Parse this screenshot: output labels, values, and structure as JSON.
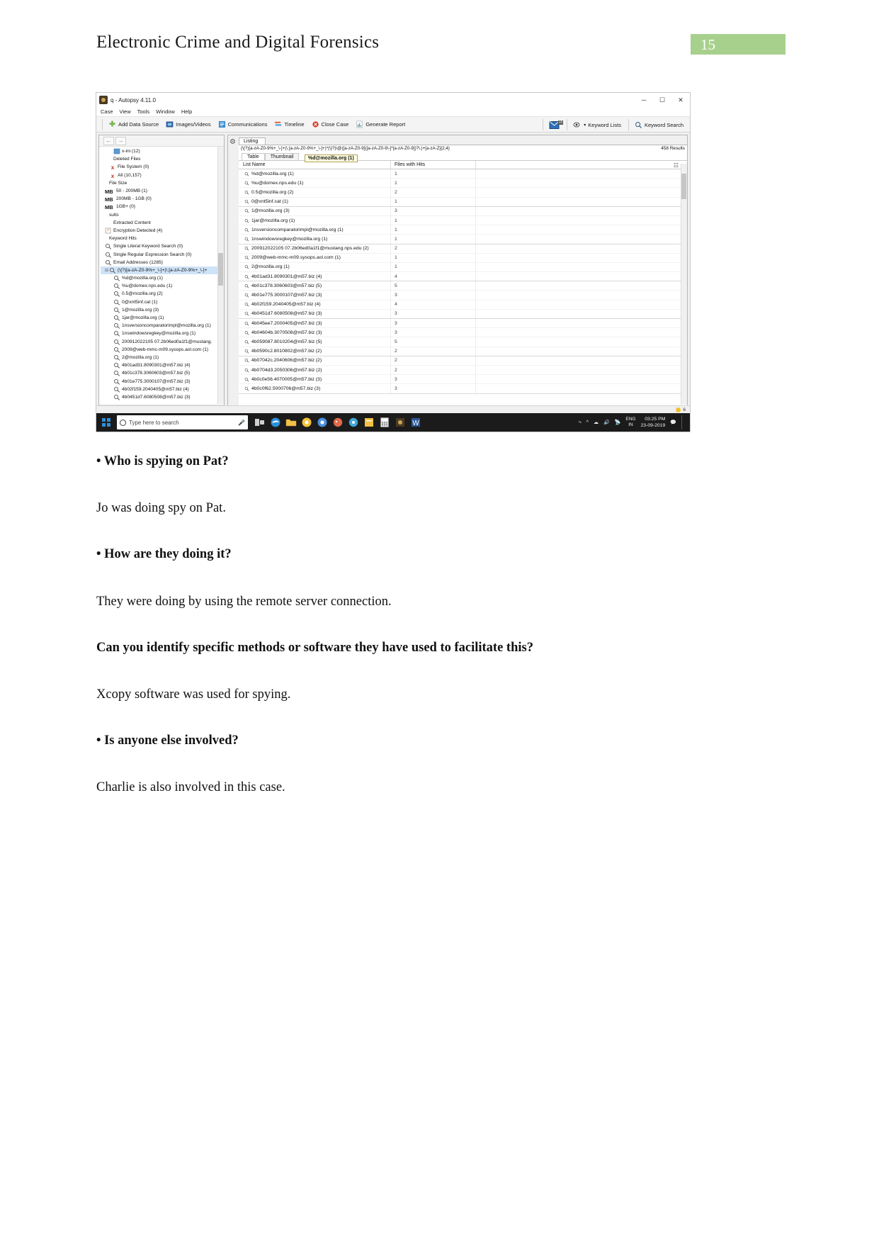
{
  "header": {
    "title": "Electronic Crime and Digital Forensics",
    "page_number": "15",
    "badge_color": "#a8d08d"
  },
  "screenshot": {
    "window": {
      "title": "q - Autopsy 4.11.0",
      "icon": "autopsy-icon",
      "minimize": "─",
      "maximize": "☐",
      "close": "✕"
    },
    "menubar": [
      "Case",
      "View",
      "Tools",
      "Window",
      "Help"
    ],
    "toolbar": [
      {
        "label": "Add Data Source",
        "icon": "plus-icon"
      },
      {
        "label": "Images/Videos",
        "icon": "images-icon"
      },
      {
        "label": "Communications",
        "icon": "communications-icon"
      },
      {
        "label": "Timeline",
        "icon": "timeline-icon"
      },
      {
        "label": "Close Case",
        "icon": "close-case-icon"
      },
      {
        "label": "Generate Report",
        "icon": "report-icon"
      }
    ],
    "toolbar_right": [
      {
        "label": "",
        "icon": "mail-icon",
        "badge": "15"
      },
      {
        "label": "Keyword Lists",
        "icon": "keyword-lists-icon"
      },
      {
        "label": "Keyword Search",
        "icon": "keyword-search-icon"
      }
    ],
    "tree": {
      "back": "←",
      "forward": "→",
      "items": [
        {
          "label": "x-ini (12)",
          "indent": 3,
          "icon": "folder-icon"
        },
        {
          "label": "Deleted Files",
          "indent": 1,
          "icon": "none"
        },
        {
          "label": "File System (0)",
          "indent": 2,
          "icon": "x-icon"
        },
        {
          "label": "All (10,157)",
          "indent": 2,
          "icon": "x-icon"
        },
        {
          "label": "File Size",
          "indent": 0,
          "icon": "none"
        },
        {
          "label": "50 - 200MB (1)",
          "indent": 1,
          "icon": "mb-icon"
        },
        {
          "label": "200MB - 1GB (0)",
          "indent": 1,
          "icon": "mb-icon"
        },
        {
          "label": "1GB+ (0)",
          "indent": 1,
          "icon": "mb-icon"
        },
        {
          "label": "sults",
          "indent": 0,
          "icon": "none"
        },
        {
          "label": "Extracted Content",
          "indent": 1,
          "icon": "none"
        },
        {
          "label": "Encryption Detected (4)",
          "indent": 1,
          "icon": "doc-icon"
        },
        {
          "label": "Keyword Hits",
          "indent": 0,
          "icon": "none"
        },
        {
          "label": "Single Literal Keyword Search (0)",
          "indent": 1,
          "icon": "search-icon"
        },
        {
          "label": "Single Regular Expression Search (0)",
          "indent": 1,
          "icon": "search-icon"
        },
        {
          "label": "Email Addresses (1285)",
          "indent": 1,
          "icon": "search-icon"
        },
        {
          "label": "(\\{?)[a-zA-Z0-9%+_\\-]+(\\.[a-zA-Z0-9%+_\\-]+",
          "indent": 1,
          "icon": "search-icon",
          "selected": true,
          "expander": "⊟"
        },
        {
          "label": "%d@mozilla.org (1)",
          "indent": 3,
          "icon": "search-icon"
        },
        {
          "label": "%u@domex.nps.edu (1)",
          "indent": 3,
          "icon": "search-icon"
        },
        {
          "label": "0.5@mozilla.org (2)",
          "indent": 3,
          "icon": "search-icon"
        },
        {
          "label": "0@xnt5inf.cat (1)",
          "indent": 3,
          "icon": "search-icon"
        },
        {
          "label": "1@mozilla.org (3)",
          "indent": 3,
          "icon": "search-icon"
        },
        {
          "label": "1jar@mozilla.org (1)",
          "indent": 3,
          "icon": "search-icon"
        },
        {
          "label": "1nsversioncomparatorimpl@mozilla.org (1)",
          "indent": 3,
          "icon": "search-icon"
        },
        {
          "label": "1nswindowsregkey@mozilla.org (1)",
          "indent": 3,
          "icon": "search-icon"
        },
        {
          "label": "200912022105 07.2b06ed0a1f1@mustang.",
          "indent": 3,
          "icon": "search-icon"
        },
        {
          "label": "2009@web-mmc-m09.sysops.aol.com (1)",
          "indent": 3,
          "icon": "search-icon"
        },
        {
          "label": "2@mozilla.org (1)",
          "indent": 3,
          "icon": "search-icon"
        },
        {
          "label": "4b01ad31.8090301@m57.biz (4)",
          "indent": 3,
          "icon": "search-icon"
        },
        {
          "label": "4b01c378.3060603@m57.biz (5)",
          "indent": 3,
          "icon": "search-icon"
        },
        {
          "label": "4b01e775.3000107@m57.biz (3)",
          "indent": 3,
          "icon": "search-icon"
        },
        {
          "label": "4b02f159.2040405@m57.biz (4)",
          "indent": 3,
          "icon": "search-icon"
        },
        {
          "label": "4b0451d7.6080508@m57.biz (3)",
          "indent": 3,
          "icon": "search-icon"
        }
      ]
    },
    "listing": {
      "tab_label": "Listing",
      "regex_path": "(\\{?)[a-zA-Z0-9%+_\\-]+(\\.[a-zA-Z0-9%+_\\-]+)*(\\}?)\\@([a-zA-Z0-9]([a-zA-Z0-9\\-]*[a-zA-Z0-9])?\\.)+[a-zA-Z]{2,4}",
      "results_count": "458 Results",
      "view_tabs": [
        "Table",
        "Thumbnail"
      ],
      "columns": [
        "List Name",
        "Files with Hits"
      ],
      "tooltip": "%d@mozilla.org (1)",
      "rows": [
        {
          "name": "%d@mozilla.org (1)",
          "hits": "1"
        },
        {
          "name": "%u@domex.nps.edu (1)",
          "hits": "1"
        },
        {
          "name": "0.5@mozilla.org (2)",
          "hits": "2"
        },
        {
          "name": "0@xnt5inf.cat (1)",
          "hits": "1"
        },
        {
          "name": "1@mozilla.org (3)",
          "hits": "3"
        },
        {
          "name": "1jar@mozilla.org (1)",
          "hits": "1"
        },
        {
          "name": "1nsversioncomparatorimpl@mozilla.org (1)",
          "hits": "1"
        },
        {
          "name": "1nswindowsregkey@mozilla.org (1)",
          "hits": "1"
        },
        {
          "name": "200912022105 07.2b06ed0a1f1@mustang.nps.edu (2)",
          "hits": "2"
        },
        {
          "name": "2009@web-mmc-m09.sysops.aol.com (1)",
          "hits": "1"
        },
        {
          "name": "2@mozilla.org (1)",
          "hits": "1"
        },
        {
          "name": "4b01ad31.8090301@m57.biz (4)",
          "hits": "4"
        },
        {
          "name": "4b01c378.3060603@m57.biz (5)",
          "hits": "5"
        },
        {
          "name": "4b01e775.3000107@m57.biz (3)",
          "hits": "3"
        },
        {
          "name": "4b02f159.2040405@m57.biz (4)",
          "hits": "4"
        },
        {
          "name": "4b0451d7.6080508@m57.biz (3)",
          "hits": "3"
        },
        {
          "name": "4b045ee7.2000405@m57.biz (3)",
          "hits": "3"
        },
        {
          "name": "4b04604b.3070508@m57.biz (3)",
          "hits": "3"
        },
        {
          "name": "4b059087.8010204@m57.biz (5)",
          "hits": "5"
        },
        {
          "name": "4b0590c2.8010802@m57.biz (2)",
          "hits": "2"
        },
        {
          "name": "4b07042c.2040606@m57.biz (2)",
          "hits": "2"
        },
        {
          "name": "4b0704d3.2050306@m57.biz (2)",
          "hits": "2"
        },
        {
          "name": "4b0c0e56.4070005@m57.biz (3)",
          "hits": "3"
        },
        {
          "name": "4b0c0f62.5000706@m57.biz (3)",
          "hits": "3"
        }
      ]
    },
    "statusbar": {
      "count": "6"
    },
    "taskbar": {
      "search_placeholder": "Type here to search",
      "language": "ENG",
      "region": "IN",
      "time": "03:25 PM",
      "date": "23-09-2019"
    }
  },
  "content": [
    {
      "type": "question",
      "text": "• Who is spying on Pat?"
    },
    {
      "type": "answer",
      "text": "Jo was doing spy on Pat."
    },
    {
      "type": "question",
      "text": "• How are they doing it?"
    },
    {
      "type": "answer",
      "text": "They were doing by using the remote server connection."
    },
    {
      "type": "question",
      "text": "Can you identify specific methods or software they have used to facilitate this?"
    },
    {
      "type": "answer",
      "text": "Xcopy software was used for spying."
    },
    {
      "type": "question",
      "text": "• Is anyone else involved?"
    },
    {
      "type": "answer",
      "text": "Charlie is also involved in this case."
    }
  ]
}
